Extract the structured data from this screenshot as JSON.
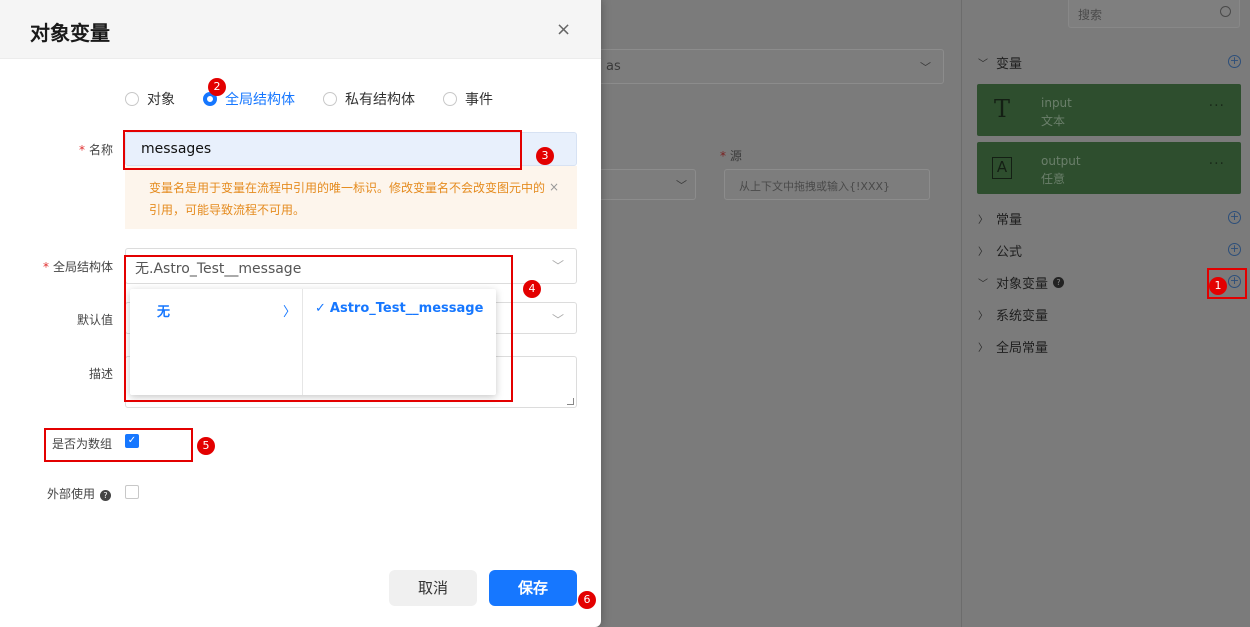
{
  "modal": {
    "title": "对象变量",
    "close_glyph": "×",
    "type_options": [
      "对象",
      "全局结构体",
      "私有结构体",
      "事件"
    ],
    "selected_type": "全局结构体",
    "name_label": "名称",
    "name_value": "messages",
    "name_warning": "变量名是用于变量在流程中引用的唯一标识。修改变量名不会改变图元中的引用，可能导致流程不可用。",
    "struct_label": "全局结构体",
    "struct_value": "无.Astro_Test__message",
    "cascader": {
      "col1": "无",
      "col2": "Astro_Test__message",
      "check_glyph": "✓"
    },
    "default_label": "默认值",
    "desc_label": "描述",
    "array_label": "是否为数组",
    "array_checked": true,
    "external_label": "外部使用",
    "external_checked": false,
    "cancel_label": "取消",
    "save_label": "保存"
  },
  "background": {
    "partial_field_text": "as",
    "source_label": "源",
    "source_placeholder": "从上下文中拖拽或输入{!XXX}"
  },
  "right_panel": {
    "search_placeholder": "搜索",
    "sections": [
      {
        "label": "变量",
        "expanded": true,
        "icon": "chevron-down-icon",
        "help": false
      },
      {
        "label": "常量",
        "expanded": false,
        "icon": "chevron-right-icon",
        "help": false
      },
      {
        "label": "公式",
        "expanded": false,
        "icon": "chevron-right-icon",
        "help": false
      },
      {
        "label": "对象变量",
        "expanded": true,
        "icon": "chevron-down-icon",
        "help": true
      },
      {
        "label": "系统变量",
        "expanded": false,
        "icon": "chevron-right-icon",
        "help": false
      },
      {
        "label": "全局常量",
        "expanded": false,
        "icon": "chevron-right-icon",
        "help": false
      }
    ],
    "variables": [
      {
        "name": "input",
        "type": "文本",
        "icon": "text-type-icon"
      },
      {
        "name": "output",
        "type": "任意",
        "icon": "any-type-icon"
      }
    ]
  },
  "annotations": [
    "1",
    "2",
    "3",
    "4",
    "5",
    "6"
  ],
  "colors": {
    "accent": "#1677ff",
    "annotation": "#e30000",
    "warning": "#e58c20"
  }
}
